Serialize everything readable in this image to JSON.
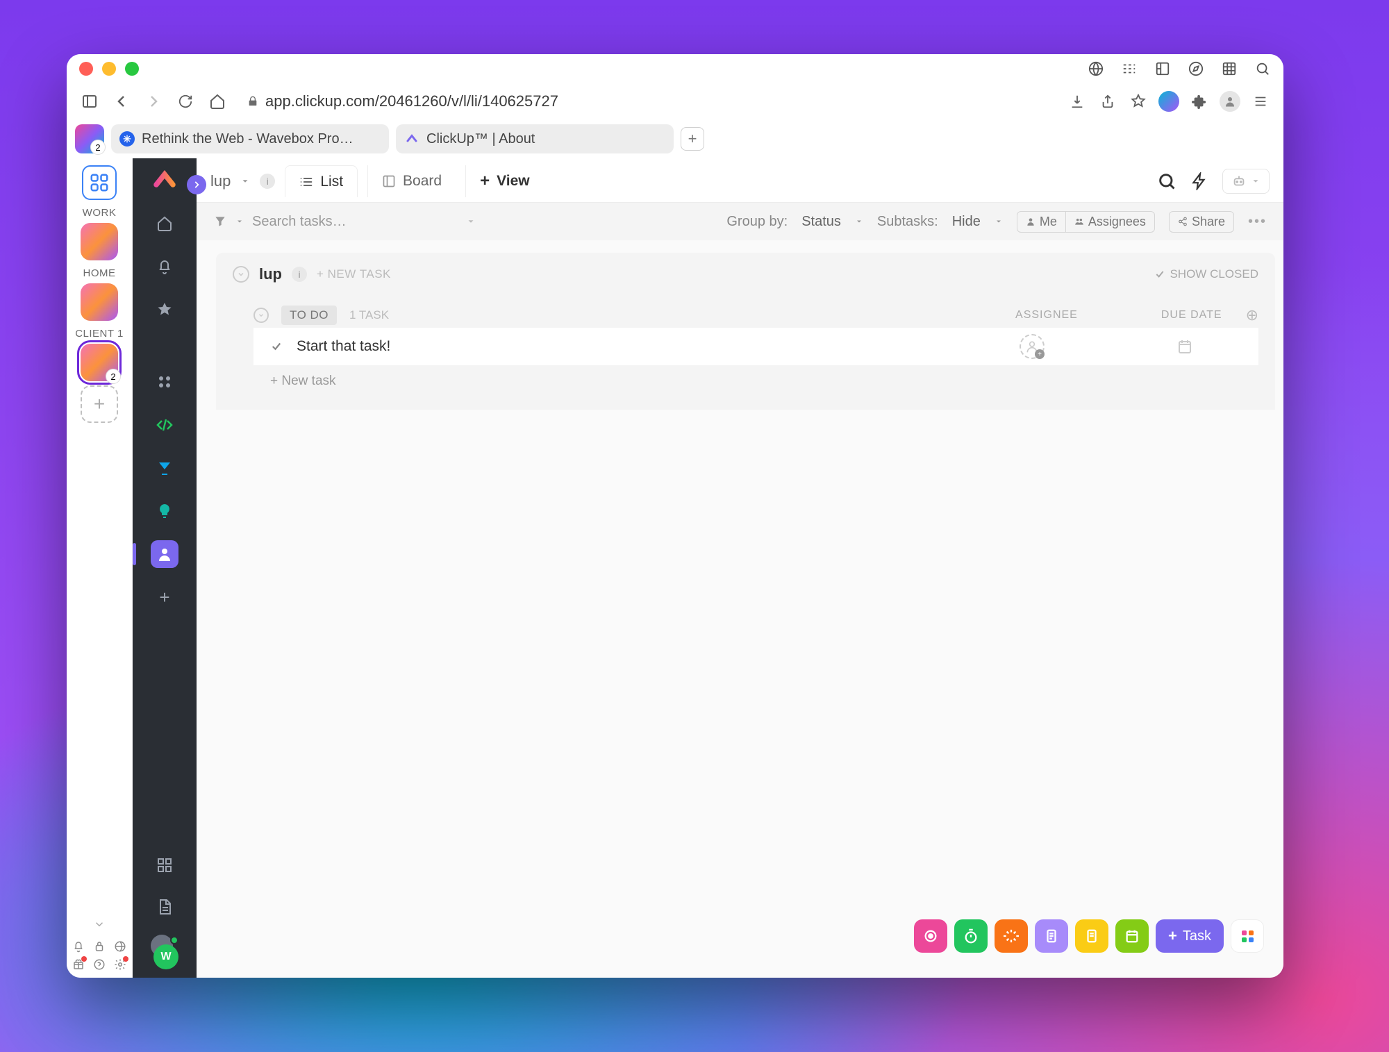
{
  "window": {
    "url": "app.clickup.com/20461260/v/l/li/140625727"
  },
  "browser_tabs": {
    "app_badge": "2",
    "tab1": "Rethink the Web - Wavebox Pro…",
    "tab2": "ClickUp™ | About"
  },
  "dock": {
    "section_work": "WORK",
    "section_home": "HOME",
    "section_client1": "CLIENT 1",
    "client_badge": "2"
  },
  "clickup_sidebar": {
    "avatar_initial": "W"
  },
  "breadcrumb": {
    "title": "lup",
    "view_list": "List",
    "view_board": "Board",
    "view_add": "View"
  },
  "filter": {
    "search_placeholder": "Search tasks…",
    "group_by_label": "Group by:",
    "group_by_value": "Status",
    "subtasks_label": "Subtasks:",
    "subtasks_value": "Hide",
    "me_btn": "Me",
    "assignees_btn": "Assignees",
    "share_btn": "Share"
  },
  "list": {
    "name": "lup",
    "new_task_label": "+ NEW TASK",
    "show_closed": "SHOW CLOSED",
    "status": "TO DO",
    "task_count": "1 TASK",
    "col_assignee": "ASSIGNEE",
    "col_due": "DUE DATE",
    "tasks": [
      {
        "title": "Start that task!"
      }
    ],
    "add_new_task": "+ New task"
  },
  "float_toolbar": {
    "task_btn": "Task"
  }
}
